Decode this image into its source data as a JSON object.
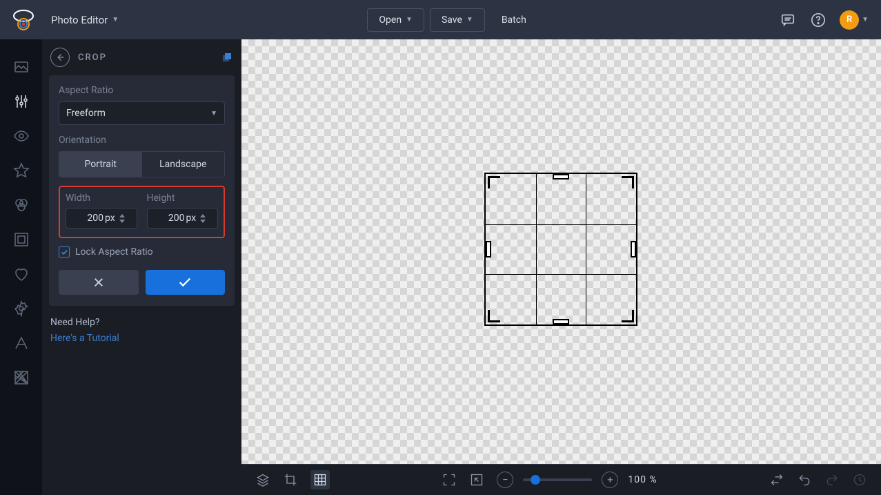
{
  "header": {
    "app_title": "Photo Editor",
    "open_label": "Open",
    "save_label": "Save",
    "batch_label": "Batch",
    "avatar_letter": "R"
  },
  "panel": {
    "title": "CROP",
    "aspect_ratio_label": "Aspect Ratio",
    "aspect_ratio_value": "Freeform",
    "orientation_label": "Orientation",
    "orientation_portrait": "Portrait",
    "orientation_landscape": "Landscape",
    "width_label": "Width",
    "height_label": "Height",
    "width_value": "200",
    "height_value": "200",
    "unit": "px",
    "lock_aspect_label": "Lock Aspect Ratio",
    "lock_aspect_checked": true
  },
  "help": {
    "question": "Need Help?",
    "link_text": "Here's a Tutorial"
  },
  "bottom": {
    "zoom_value": "100 %"
  }
}
